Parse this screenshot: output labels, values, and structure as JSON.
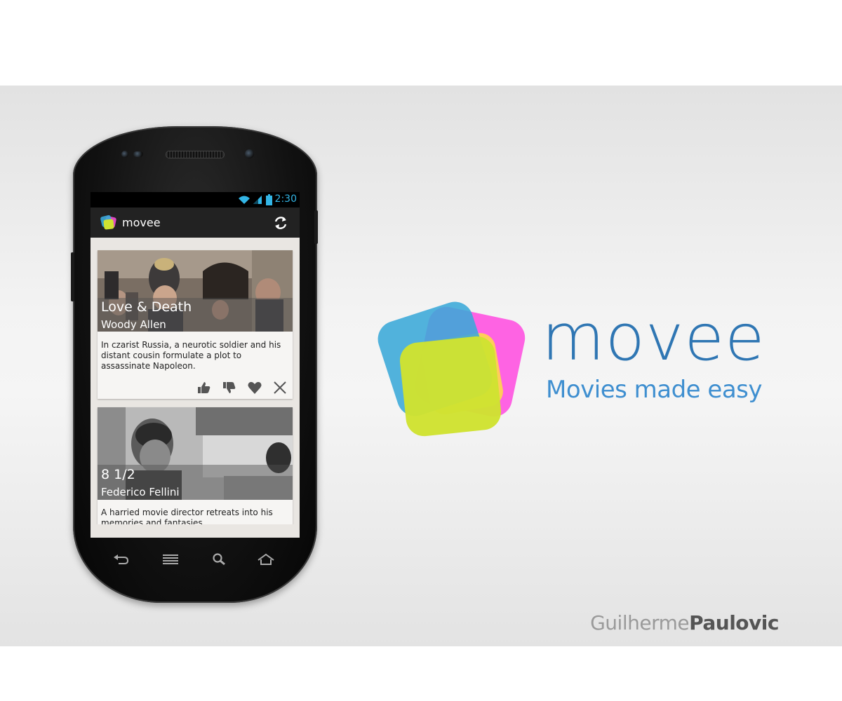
{
  "status_bar": {
    "time": "2:30"
  },
  "action_bar": {
    "title": "movee",
    "logo_icon": "movee-logo-icon",
    "refresh_icon": "refresh-icon"
  },
  "cards": [
    {
      "title": "Love & Death",
      "director": "Woody Allen",
      "description": "In czarist Russia, a neurotic soldier and his distant cousin formulate a plot to assassinate Napoleon.",
      "actions": [
        "thumbs-up-icon",
        "thumbs-down-icon",
        "heart-icon",
        "close-icon"
      ]
    },
    {
      "title": "8 1/2",
      "director": "Federico Fellini",
      "description": "A harried movie director retreats into his memories and fantasies."
    }
  ],
  "nav_buttons": [
    "back-icon",
    "menu-icon",
    "search-icon",
    "home-icon"
  ],
  "brand": {
    "name": "movee",
    "tagline": "Movies made easy",
    "colors": {
      "blue": "#2f76b3",
      "cyan": "#3aa8d8",
      "magenta": "#ff4fe0",
      "yellow": "#ffd84a",
      "lime": "#cfe231"
    }
  },
  "credit": {
    "first": "Guilherme",
    "last": "Paulovic"
  },
  "colors": {
    "holo_blue": "#33b5e5",
    "action_bar": "#222222"
  }
}
